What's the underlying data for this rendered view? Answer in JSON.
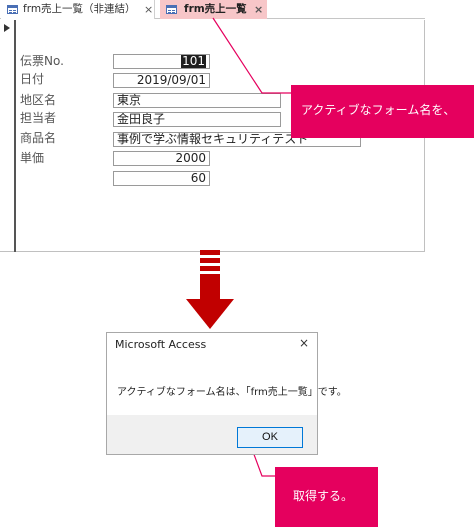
{
  "tabs": [
    {
      "label": "frm売上一覧（非連結）",
      "close": "×",
      "active": false
    },
    {
      "label": "frm売上一覧",
      "close": "×",
      "active": true
    }
  ],
  "fields": [
    {
      "label": "伝票No.",
      "value": "101",
      "selected": true
    },
    {
      "label": "日付",
      "value": "2019/09/01"
    },
    {
      "label": "地区名",
      "value": "東京"
    },
    {
      "label": "担当者",
      "value": "金田良子"
    },
    {
      "label": "商品名",
      "value": "事例で学ぶ情報セキュリティテスト"
    },
    {
      "label": "単価",
      "value": "2000"
    },
    {
      "label": "",
      "value": "60"
    }
  ],
  "callout_top": {
    "text": "アクティブなフォーム名を、"
  },
  "dialog": {
    "title": "Microsoft Access",
    "close": "×",
    "message": "アクティブなフォーム名は、「frm売上一覧」です。",
    "ok_label": "OK"
  },
  "callout_bottom": {
    "text": "取得する。"
  },
  "colors": {
    "accent_pink": "#e5005e",
    "active_tab": "#f7c6c8",
    "arrow_red": "#c10000",
    "ok_border": "#0078d7"
  }
}
